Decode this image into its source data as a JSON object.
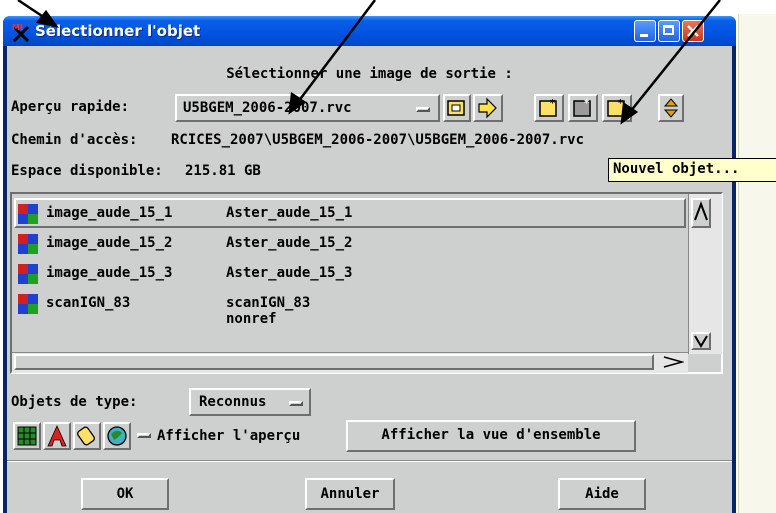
{
  "window": {
    "title": "Sélectionner l'objet",
    "colors": {
      "titlebar": "#0053e0",
      "client": "#ced0cf",
      "tooltip_bg": "#ffffcc"
    }
  },
  "header": {
    "prompt": "Sélectionner une image de sortie :"
  },
  "quick_view": {
    "label": "Aperçu rapide:",
    "value": "U5BGEM_2006-2007.rvc"
  },
  "path": {
    "label": "Chemin d'accès:",
    "value": "RCICES_2007\\U5BGEM_2006-2007\\U5BGEM_2006-2007.rvc"
  },
  "space": {
    "label": "Espace disponible:",
    "value": "215.81 GB"
  },
  "tooltip": {
    "text": "Nouvel objet..."
  },
  "objects": [
    {
      "name": "image_aude_15_1",
      "description": "Aster_aude_15_1",
      "selected": true
    },
    {
      "name": "image_aude_15_2",
      "description": "Aster_aude_15_2",
      "selected": false
    },
    {
      "name": "image_aude_15_3",
      "description": "Aster_aude_15_3",
      "selected": false
    },
    {
      "name": "scanIGN_83",
      "description": "scanIGN_83 nonref",
      "selected": false
    }
  ],
  "filter": {
    "label": "Objets de type:",
    "value": "Reconnus"
  },
  "preview": {
    "checkbox_label": "Afficher l'aperçu",
    "overview_button": "Afficher la vue d'ensemble"
  },
  "footer": {
    "ok": "OK",
    "cancel": "Annuler",
    "help": "Aide"
  },
  "icons": {
    "title": "tntmips-x-icon",
    "toolbar": [
      "folder-up-icon",
      "navigate-arrow-icon",
      "new-file-icon",
      "new-object-icon",
      "new-object-alt-icon",
      "scroll-updown-icon"
    ],
    "bottom": [
      "grid-tool-icon",
      "text-tool-icon",
      "link-tool-icon",
      "globe-tool-icon"
    ]
  }
}
